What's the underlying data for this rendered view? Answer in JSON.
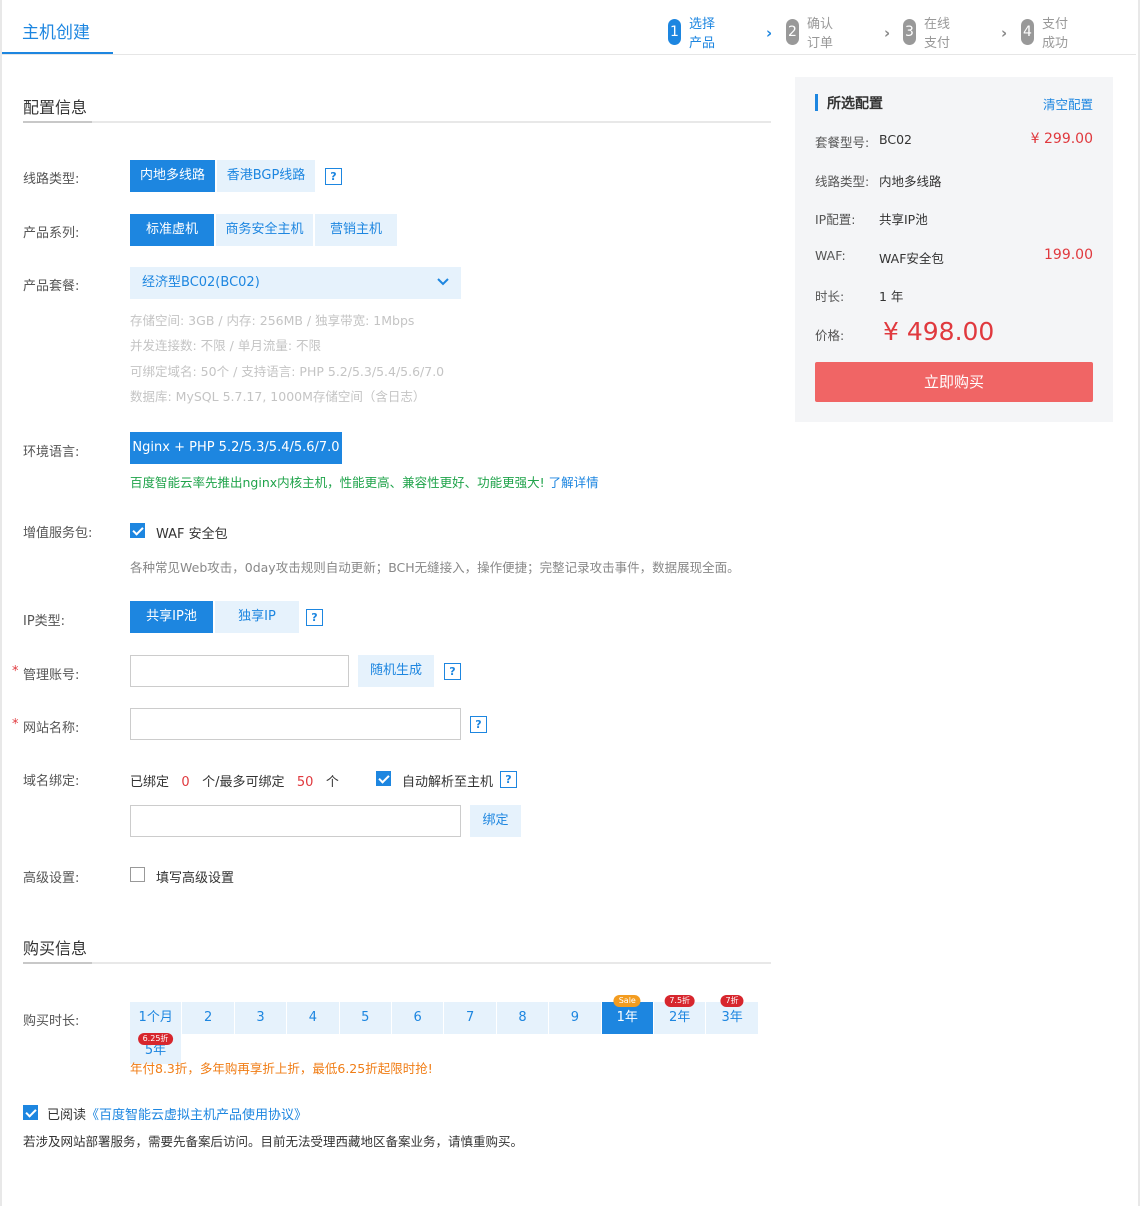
{
  "header": {
    "title": "主机创建",
    "steps": [
      {
        "num": "1",
        "label": "选择产品"
      },
      {
        "num": "2",
        "label": "确认订单"
      },
      {
        "num": "3",
        "label": "在线支付"
      },
      {
        "num": "4",
        "label": "支付成功"
      }
    ]
  },
  "config": {
    "section_title": "配置信息",
    "line_type": {
      "label": "线路类型:",
      "options": [
        "内地多线路",
        "香港BGP线路"
      ],
      "selected": "内地多线路"
    },
    "series": {
      "label": "产品系列:",
      "options": [
        "标准虚机",
        "商务安全主机",
        "营销主机"
      ],
      "selected": "标准虚机"
    },
    "package": {
      "label": "产品套餐:",
      "value": "经济型BC02(BC02)",
      "details": [
        "存储空间: 3GB / 内存: 256MB / 独享带宽: 1Mbps",
        "并发连接数: 不限 / 单月流量: 不限",
        "可绑定域名: 50个 / 支持语言: PHP 5.2/5.3/5.4/5.6/7.0",
        "数据库: MySQL 5.7.17, 1000M存储空间（含日志）"
      ]
    },
    "env": {
      "label": "环境语言:",
      "value": "Nginx + PHP 5.2/5.3/5.4/5.6/7.0",
      "note": "百度智能云率先推出nginx内核主机，性能更高、兼容性更好、功能更强大! ",
      "note_link": "了解详情"
    },
    "addon": {
      "label": "增值服务包:",
      "checkbox_label": "WAF 安全包",
      "checked": true,
      "desc": "各种常见Web攻击，0day攻击规则自动更新；BCH无缝接入，操作便捷；完整记录攻击事件，数据展现全面。"
    },
    "ip_type": {
      "label": "IP类型:",
      "options": [
        "共享IP池",
        "独享IP"
      ],
      "selected": "共享IP池"
    },
    "admin": {
      "required_mark": "*",
      "label": "管理账号:",
      "value": "",
      "random_button": "随机生成"
    },
    "site_name": {
      "required_mark": "*",
      "label": "网站名称:",
      "value": ""
    },
    "domain": {
      "label": "域名绑定:",
      "bound_prefix": "已绑定",
      "bound_count": "0",
      "bound_mid": "个/最多可绑定",
      "max_count": "50",
      "bound_suffix": "个",
      "auto_resolve_label": "自动解析至主机",
      "auto_resolve_checked": true,
      "input_value": "",
      "bind_button": "绑定"
    },
    "advanced": {
      "label": "高级设置:",
      "checkbox_label": "填写高级设置",
      "checked": false
    }
  },
  "purchase": {
    "section_title": "购买信息",
    "duration_label": "购买时长:",
    "durations": [
      {
        "text": "1个月",
        "badge": ""
      },
      {
        "text": "2",
        "badge": ""
      },
      {
        "text": "3",
        "badge": ""
      },
      {
        "text": "4",
        "badge": ""
      },
      {
        "text": "5",
        "badge": ""
      },
      {
        "text": "6",
        "badge": ""
      },
      {
        "text": "7",
        "badge": ""
      },
      {
        "text": "8",
        "badge": ""
      },
      {
        "text": "9",
        "badge": ""
      },
      {
        "text": "1年",
        "badge": "Sale"
      },
      {
        "text": "2年",
        "badge": "7.5折"
      },
      {
        "text": "3年",
        "badge": "7折"
      },
      {
        "text": "5年",
        "badge": "6.25折"
      }
    ],
    "selected_duration": "1年",
    "discount_note": "年付8.3折，多年购再享折上折，最低6.25折起限时抢!",
    "agree_prefix": "已阅读",
    "agree_link": "《百度智能云虚拟主机产品使用协议》",
    "agree_checked": true,
    "bottom_note": "若涉及网站部署服务，需要先备案后访问。目前无法受理西藏地区备案业务，请慎重购买。"
  },
  "summary": {
    "title": "所选配置",
    "clear": "清空配置",
    "rows": [
      {
        "label": "套餐型号:",
        "value": "BC02",
        "price": "¥ 299.00"
      },
      {
        "label": "线路类型:",
        "value": "内地多线路",
        "price": ""
      },
      {
        "label": "IP配置:",
        "value": "共享IP池",
        "price": ""
      },
      {
        "label": "WAF:",
        "value": "WAF安全包",
        "price": "199.00"
      },
      {
        "label": "时长:",
        "value": "1 年",
        "price": ""
      }
    ],
    "total_label": "价格:",
    "total": "¥ 498.00",
    "buy_button": "立即购买"
  },
  "colors": {
    "primary": "#1d86e0",
    "danger": "#e0393e",
    "buy": "#f06565",
    "success": "#1fa34a",
    "warning": "#f07d16"
  }
}
